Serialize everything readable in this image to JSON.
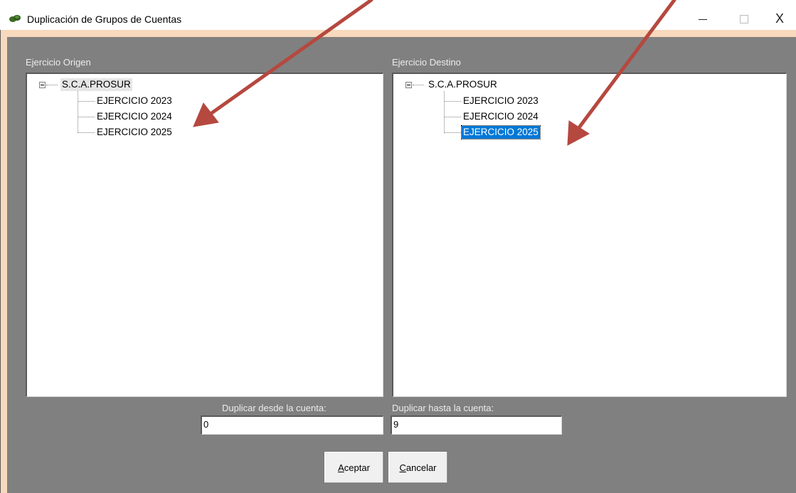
{
  "window": {
    "title": "Duplicación de Grupos de Cuentas",
    "minimize_icon": "minimize-icon",
    "maximize_icon": "maximize-icon",
    "close_glyph": "X"
  },
  "origin": {
    "label": "Ejercicio Origen",
    "root": "S.C.A.PROSUR",
    "items": [
      "EJERCICIO 2023",
      "EJERCICIO 2024",
      "EJERCICIO 2025"
    ]
  },
  "destination": {
    "label": "Ejercicio Destino",
    "root": "S.C.A.PROSUR",
    "items": [
      "EJERCICIO 2023",
      "EJERCICIO 2024",
      "EJERCICIO 2025"
    ],
    "selected": "EJERCICIO 2025"
  },
  "range": {
    "from_label": "Duplicar desde la cuenta:",
    "from_value": "0",
    "to_label": "Duplicar hasta la cuenta:",
    "to_value": "9"
  },
  "buttons": {
    "accept_mnemonic": "A",
    "accept_rest": "ceptar",
    "cancel_mnemonic": "C",
    "cancel_rest": "ancelar"
  },
  "colors": {
    "client_bg": "#808080",
    "frame": "#f7d9bd",
    "selection": "#0078d7",
    "arrow": "#b5483f"
  }
}
